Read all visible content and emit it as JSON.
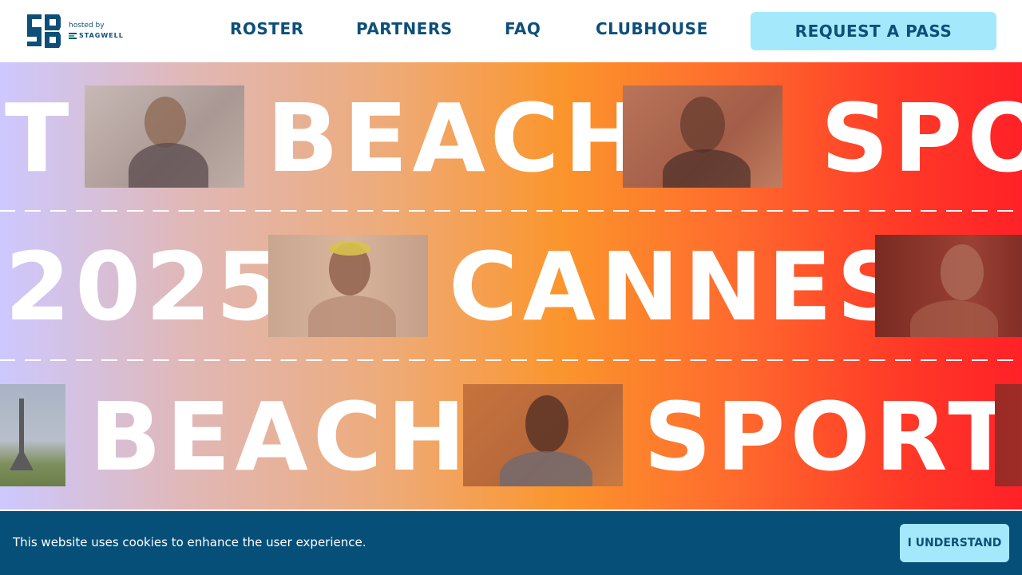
{
  "header": {
    "hosted_by": "hosted by",
    "stagwell": "STAGWELL",
    "nav": {
      "roster": "ROSTER",
      "partners": "PARTNERS",
      "faq": "FAQ",
      "clubhouse": "CLUBHOUSE"
    },
    "cta_label": "REQUEST A PASS"
  },
  "hero": {
    "row1": {
      "left_fragment": "T",
      "word": "BEACH",
      "right_fragment": "SPO"
    },
    "row2": {
      "year": "2025",
      "word": "CANNES"
    },
    "row3": {
      "word1": "BEACH",
      "word2": "SPORT"
    }
  },
  "cookie": {
    "message": "This website uses cookies to enhance the user experience.",
    "button_label": "I UNDERSTAND"
  },
  "colors": {
    "brand_navy": "#0d4f78",
    "cta_bg": "#a4e9fb",
    "cookie_bg": "#064f78"
  }
}
